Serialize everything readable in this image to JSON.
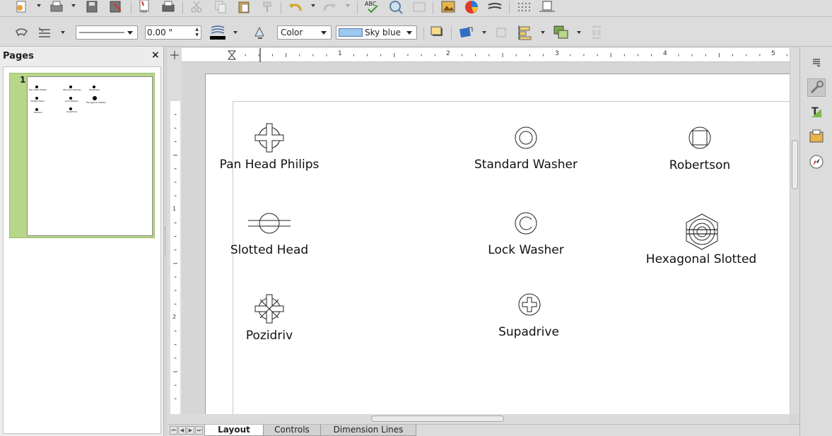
{
  "toolbar2": {
    "line_width_value": "0.00 \"",
    "area_style_value": "Color",
    "fill_color_value": "Sky blue",
    "fill_color_hex": "#9cc8f2"
  },
  "pages_panel": {
    "title": "Pages",
    "close_glyph": "×",
    "page_number": "1",
    "thumb_labels": [
      "Pan Head Philips",
      "Standard Washer",
      "Robertson",
      "Slotted Head",
      "Lock Washer",
      "Hexagonal Slotted",
      "Pozidriv",
      "Supadrive"
    ]
  },
  "ruler": {
    "h_numbers": [
      "1",
      "2",
      "3",
      "4",
      "5"
    ],
    "v_numbers": [
      "1",
      "2"
    ]
  },
  "shapes": {
    "pan_head_philips": "Pan Head Philips",
    "standard_washer": "Standard Washer",
    "robertson": "Robertson",
    "slotted_head": "Slotted Head",
    "lock_washer": "Lock Washer",
    "hexagonal_slotted": "Hexagonal Slotted",
    "pozidriv": "Pozidriv",
    "supadrive": "Supadrive"
  },
  "tabs": {
    "layout": "Layout",
    "controls": "Controls",
    "dimension_lines": "Dimension Lines"
  },
  "icons": {
    "toolbar1": [
      "new-icon",
      "templates-icon",
      "save-icon",
      "save-as-icon",
      "export-pdf-icon",
      "print-icon",
      "cut-icon",
      "copy-icon",
      "paste-icon",
      "clone-formatting-icon",
      "undo-icon",
      "redo-icon",
      "spellcheck-icon",
      "zoom-icon",
      "zoom-pan-icon",
      "image-icon",
      "chart-icon",
      "fontwork-icon",
      "grid-icon",
      "helplines-icon"
    ],
    "toolbar2": [
      "select-icon",
      "line-style-icon",
      "line-width-icon",
      "line-color-icon",
      "area-icon",
      "shadow-icon",
      "transform-icon",
      "crop-icon",
      "align-icon",
      "arrange-icon",
      "distribute-icon"
    ],
    "sidebar": [
      "sidebar-menu-icon",
      "properties-icon",
      "styles-icon",
      "gallery-icon",
      "navigator-icon"
    ]
  }
}
